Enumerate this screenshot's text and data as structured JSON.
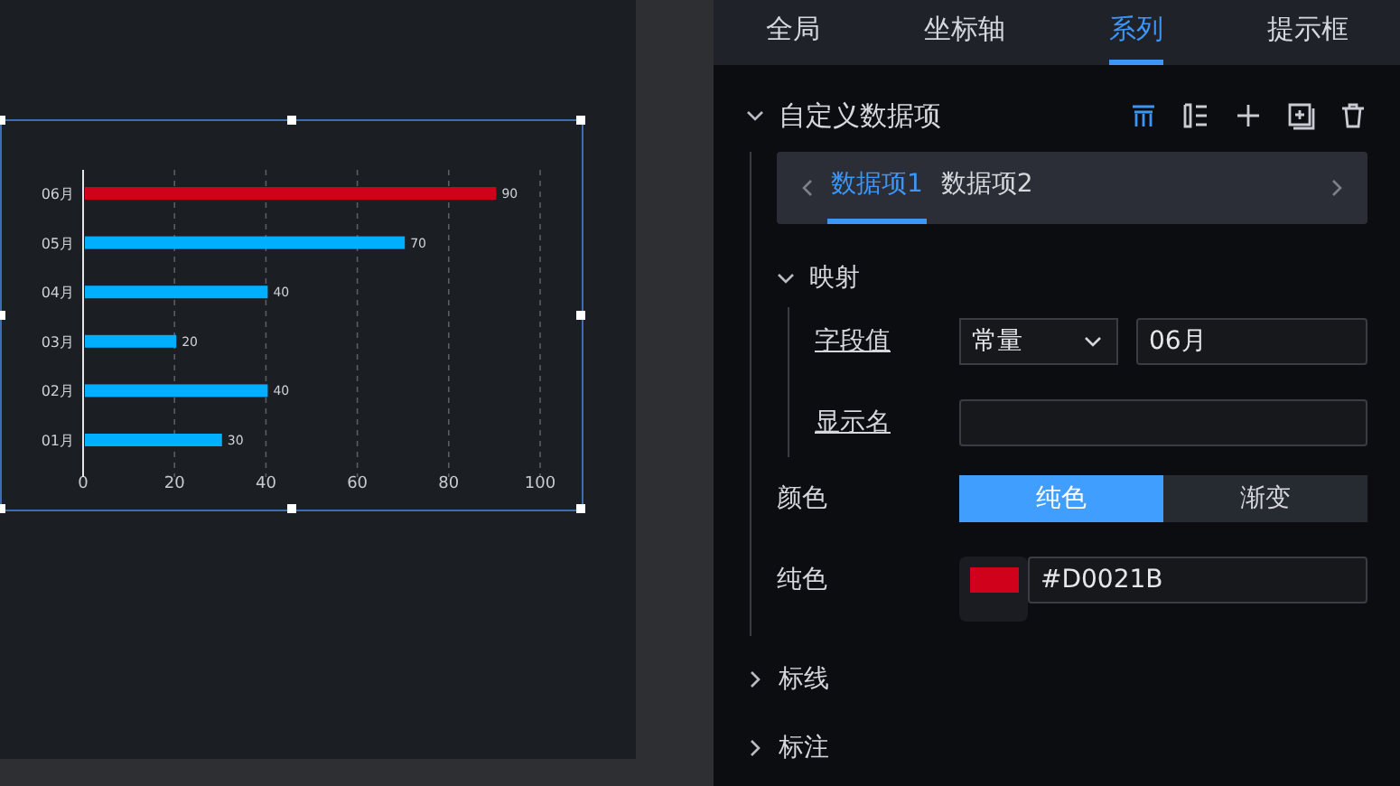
{
  "canvas": {
    "chart_data": {
      "type": "bar",
      "orientation": "horizontal",
      "categories": [
        "06月",
        "05月",
        "04月",
        "03月",
        "02月",
        "01月"
      ],
      "series": [
        {
          "color": "#d0021b",
          "values": [
            90,
            null,
            null,
            null,
            null,
            null
          ]
        },
        {
          "color": "#00b0ff",
          "values": [
            null,
            70,
            40,
            20,
            40,
            30
          ]
        }
      ],
      "grid": true,
      "xlim": [
        0,
        100
      ],
      "xticks": [
        0,
        20,
        40,
        60,
        80,
        100
      ],
      "data_labels": true
    }
  },
  "panel": {
    "tabs": [
      {
        "label": "全局",
        "selected": false
      },
      {
        "label": "坐标轴",
        "selected": false
      },
      {
        "label": "系列",
        "selected": true
      },
      {
        "label": "提示框",
        "selected": false
      }
    ],
    "custom_items": {
      "title": "自定义数据项",
      "expanded": true,
      "item_tabs": [
        {
          "label": "数据项1",
          "selected": true
        },
        {
          "label": "数据项2",
          "selected": false
        }
      ],
      "mapping": {
        "title": "映射",
        "expanded": true,
        "field_label": "字段值",
        "mode": "常量",
        "field_value": "06月",
        "display_label": "显示名"
      },
      "color_label": "颜色",
      "color_options": [
        {
          "label": "纯色",
          "selected": true
        },
        {
          "label": "渐变",
          "selected": false
        }
      ],
      "solid_label": "纯色",
      "solid_value": "#D0021B"
    },
    "sections": [
      {
        "title": "标线",
        "expanded": false
      },
      {
        "title": "标注",
        "expanded": false
      }
    ]
  }
}
